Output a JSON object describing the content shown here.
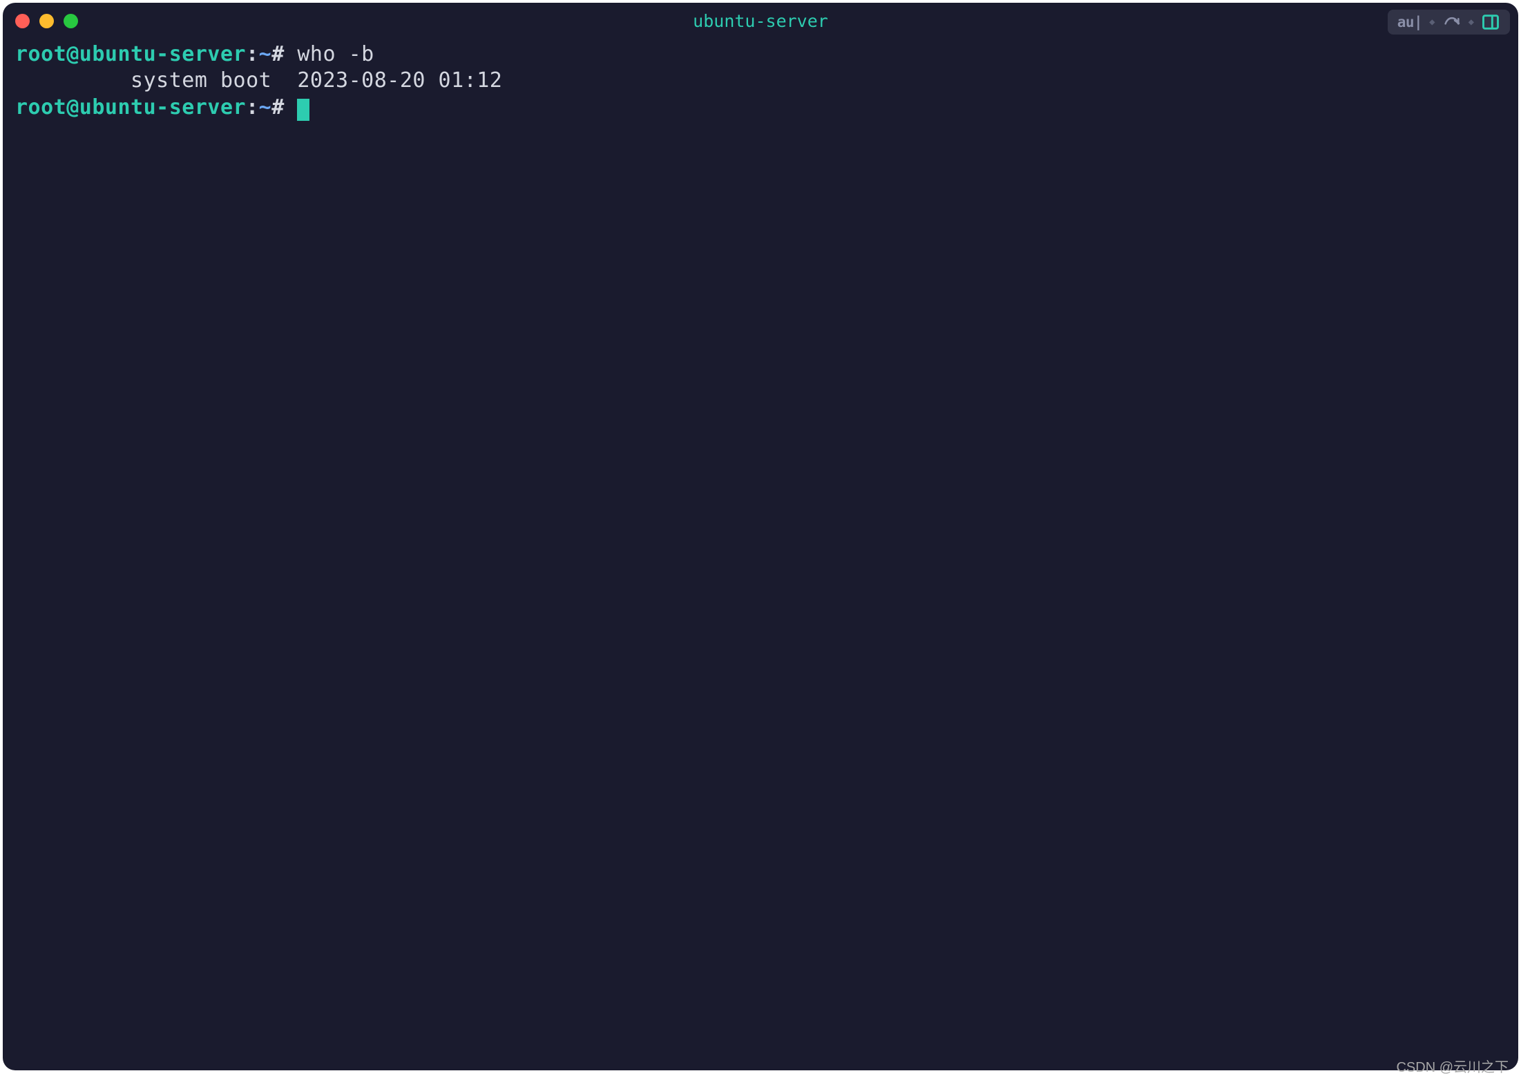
{
  "window": {
    "title": "ubuntu-server"
  },
  "toolbar": {
    "mode_label": "au|"
  },
  "terminal": {
    "lines": [
      {
        "prompt_user": "root@ubuntu-server",
        "prompt_colon": ":",
        "prompt_path": "~",
        "prompt_hash": "#",
        "command": " who -b"
      }
    ],
    "output": "         system boot  2023-08-20 01:12",
    "prompt2": {
      "prompt_user": "root@ubuntu-server",
      "prompt_colon": ":",
      "prompt_path": "~",
      "prompt_hash": "#",
      "command": " "
    }
  },
  "watermark": "CSDN @云川之下",
  "colors": {
    "background": "#1a1b2e",
    "prompt_green": "#2dccb0",
    "prompt_blue": "#6ca8f5",
    "text": "#d4d7e0",
    "traffic_red": "#ff5f57",
    "traffic_yellow": "#febc2e",
    "traffic_green": "#28c840"
  }
}
